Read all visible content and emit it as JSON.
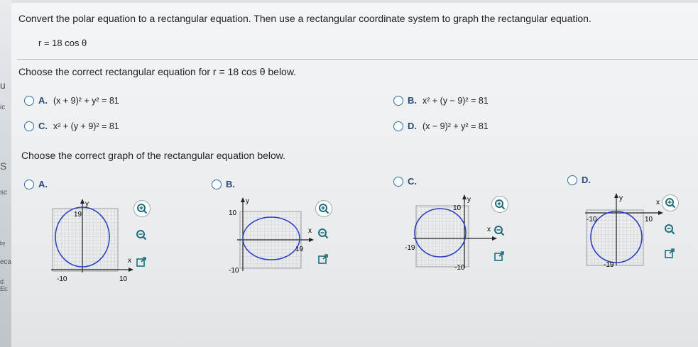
{
  "question": "Convert the polar equation to a rectangular equation. Then use a rectangular coordinate system to graph the rectangular equation.",
  "given": "r = 18 cos θ",
  "prompt_equation": "Choose the correct rectangular equation for r = 18 cos θ below.",
  "equation_options": [
    {
      "letter": "A.",
      "text": "(x + 9)² + y² = 81"
    },
    {
      "letter": "B.",
      "text": "x² + (y − 9)² = 81"
    },
    {
      "letter": "C.",
      "text": "x² + (y + 9)² = 81"
    },
    {
      "letter": "D.",
      "text": "(x − 9)² + y² = 81"
    }
  ],
  "prompt_graph": "Choose the correct graph of the rectangular equation below.",
  "graph_options": [
    {
      "letter": "A.",
      "ticks": [
        "19",
        "-10",
        "10"
      ]
    },
    {
      "letter": "B.",
      "ticks": [
        "10",
        "-10",
        "19"
      ]
    },
    {
      "letter": "C.",
      "ticks": [
        "10",
        "-19",
        "-10"
      ]
    },
    {
      "letter": "D.",
      "ticks": [
        "-10",
        "10",
        "-19"
      ]
    }
  ],
  "axis_labels": {
    "x": "x",
    "y": "y"
  },
  "left_strip": [
    "u",
    "ic",
    "S",
    "sc",
    "by",
    "eca",
    "d Ec"
  ],
  "colors": {
    "circle": "#2b3fbf",
    "radio": "#2b6fb3",
    "grid": "#b9bec4"
  }
}
